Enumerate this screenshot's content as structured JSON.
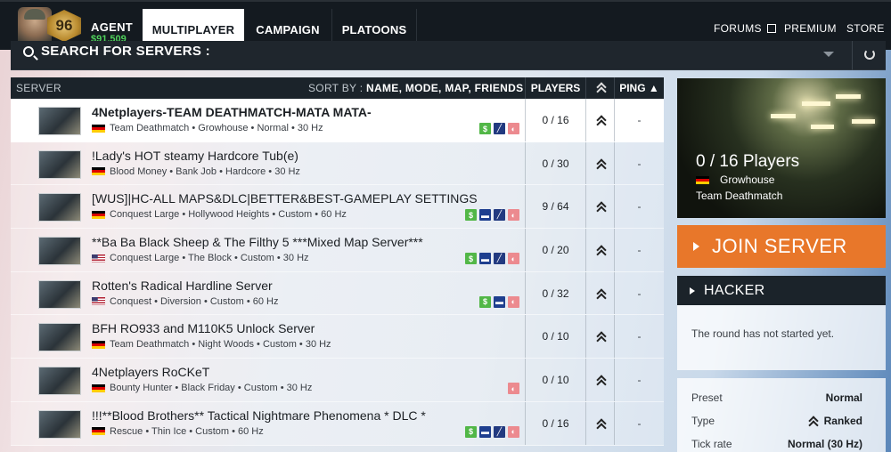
{
  "header": {
    "rank_number": "96",
    "agent_name": "AGENT",
    "agent_money": "$91,509",
    "tabs": [
      "MULTIPLAYER",
      "CAMPAIGN",
      "PLATOONS"
    ],
    "active_tab": "MULTIPLAYER",
    "links": [
      "FORUMS",
      "PREMIUM",
      "STORE"
    ]
  },
  "search": {
    "label": "SEARCH FOR SERVERS :"
  },
  "table": {
    "col_server": "SERVER",
    "sort_by_prefix": "SORT BY :",
    "sort_by_options": "NAME, MODE, MAP, FRIENDS",
    "col_players": "PLAYERS",
    "col_ping": "PING ▲",
    "rows": [
      {
        "name": "4Netplayers-TEAM DEATHMATCH-MATA MATA-",
        "flag": "de",
        "info": "Team Deathmatch • Growhouse • Normal • 30 Hz",
        "players": "0 / 16",
        "ping": "-",
        "badges": [
          "money",
          "edit",
          "unranked"
        ]
      },
      {
        "name": "!Lady's HOT steamy Hardcore Tub(e)",
        "flag": "de",
        "info": "Blood Money • Bank Job • Hardcore • 30 Hz",
        "players": "0 / 30",
        "ping": "-",
        "badges": []
      },
      {
        "name": "[WUS]|HC-ALL MAPS&DLC|BETTER&BEST-GAMEPLAY SETTINGS",
        "flag": "de",
        "info": "Conquest Large • Hollywood Heights • Custom • 60 Hz",
        "players": "9 / 64",
        "ping": "-",
        "badges": [
          "money",
          "vip",
          "edit",
          "unranked"
        ]
      },
      {
        "name": "**Ba Ba Black Sheep & The Filthy 5 ***Mixed Map Server***",
        "flag": "us",
        "info": "Conquest Large • The Block • Custom • 30 Hz",
        "players": "0 / 20",
        "ping": "-",
        "badges": [
          "money",
          "vip",
          "edit",
          "unranked"
        ]
      },
      {
        "name": "Rotten's Radical Hardline Server",
        "flag": "us",
        "info": "Conquest • Diversion • Custom • 60 Hz",
        "players": "0 / 32",
        "ping": "-",
        "badges": [
          "money",
          "vip",
          "unranked"
        ]
      },
      {
        "name": "BFH RO933 and M110K5 Unlock Server",
        "flag": "de",
        "info": "Team Deathmatch • Night Woods • Custom • 30 Hz",
        "players": "0 / 10",
        "ping": "-",
        "badges": []
      },
      {
        "name": "4Netplayers RoCKeT",
        "flag": "de",
        "info": "Bounty Hunter • Black Friday • Custom • 30 Hz",
        "players": "0 / 10",
        "ping": "-",
        "badges": [
          "unranked"
        ]
      },
      {
        "name": "!!!**Blood Brothers** Tactical Nightmare Phenomena * DLC *",
        "flag": "de",
        "info": "Rescue • Thin Ice • Custom • 60 Hz",
        "players": "0 / 16",
        "ping": "-",
        "badges": [
          "money",
          "vip",
          "edit",
          "unranked"
        ]
      }
    ]
  },
  "side": {
    "preview_players": "0 / 16 Players",
    "preview_map": "Growhouse",
    "preview_mode": "Team Deathmatch",
    "join_label": "JOIN SERVER",
    "server_title": "HACKER",
    "status": "The round has not started yet.",
    "settings": [
      {
        "label": "Preset",
        "value": "Normal"
      },
      {
        "label": "Type",
        "value": "Ranked"
      },
      {
        "label": "Tick rate",
        "value": "Normal (30 Hz)"
      }
    ]
  },
  "icons": {
    "money_badge": "$",
    "ranked": "chevron-rank-icon"
  },
  "colors": {
    "accent_orange": "#e8772a",
    "nav_dark": "#141a20",
    "money_green": "#4fd15b"
  }
}
